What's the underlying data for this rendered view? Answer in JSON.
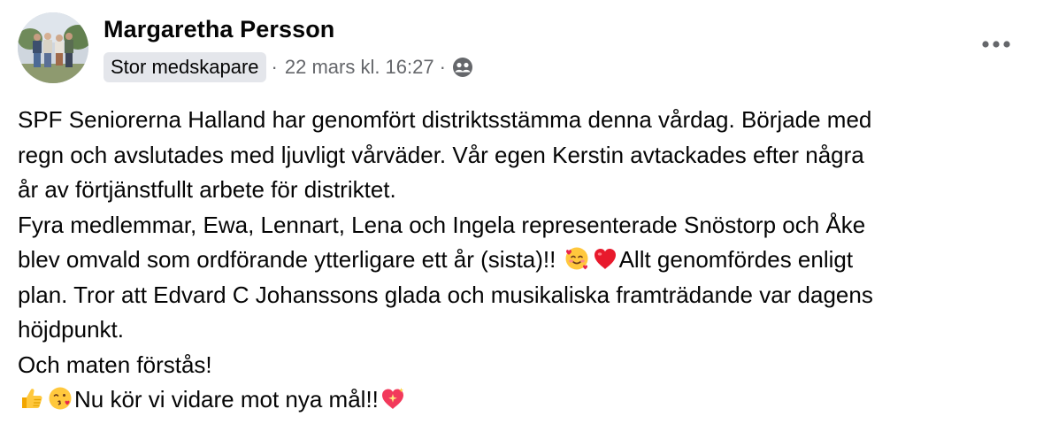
{
  "post": {
    "author": "Margaretha Persson",
    "badge": "Stor medskapare",
    "separator": "·",
    "timestamp": "22 mars kl. 16:27",
    "audience_icon": "friends-icon",
    "menu_icon": "more-options-icon",
    "lines": [
      "SPF Seniorerna Halland har genomfört distriktsstämma denna vårdag. Började med",
      "regn och avslutades med ljuvligt vårväder. Vår egen Kerstin avtackades efter några",
      "år av förtjänstfullt arbete för distriktet.",
      "Fyra medlemmar, Ewa, Lennart, Lena och Ingela representerade  Snöstorp och Åke",
      "blev omvald som ordförande ytterligare ett år (sista)!!",
      "Allt genomfördes enligt",
      "plan. Tror att Edvard C Johanssons glada och musikaliska framträdande var dagens",
      "höjdpunkt.",
      "Och maten förstås!",
      "Nu kör vi vidare mot nya mål!!"
    ],
    "emojis": [
      "smiling-face-with-hearts",
      "red-heart",
      "thumbs-up",
      "face-blowing-kiss",
      "sparkling-heart"
    ]
  }
}
